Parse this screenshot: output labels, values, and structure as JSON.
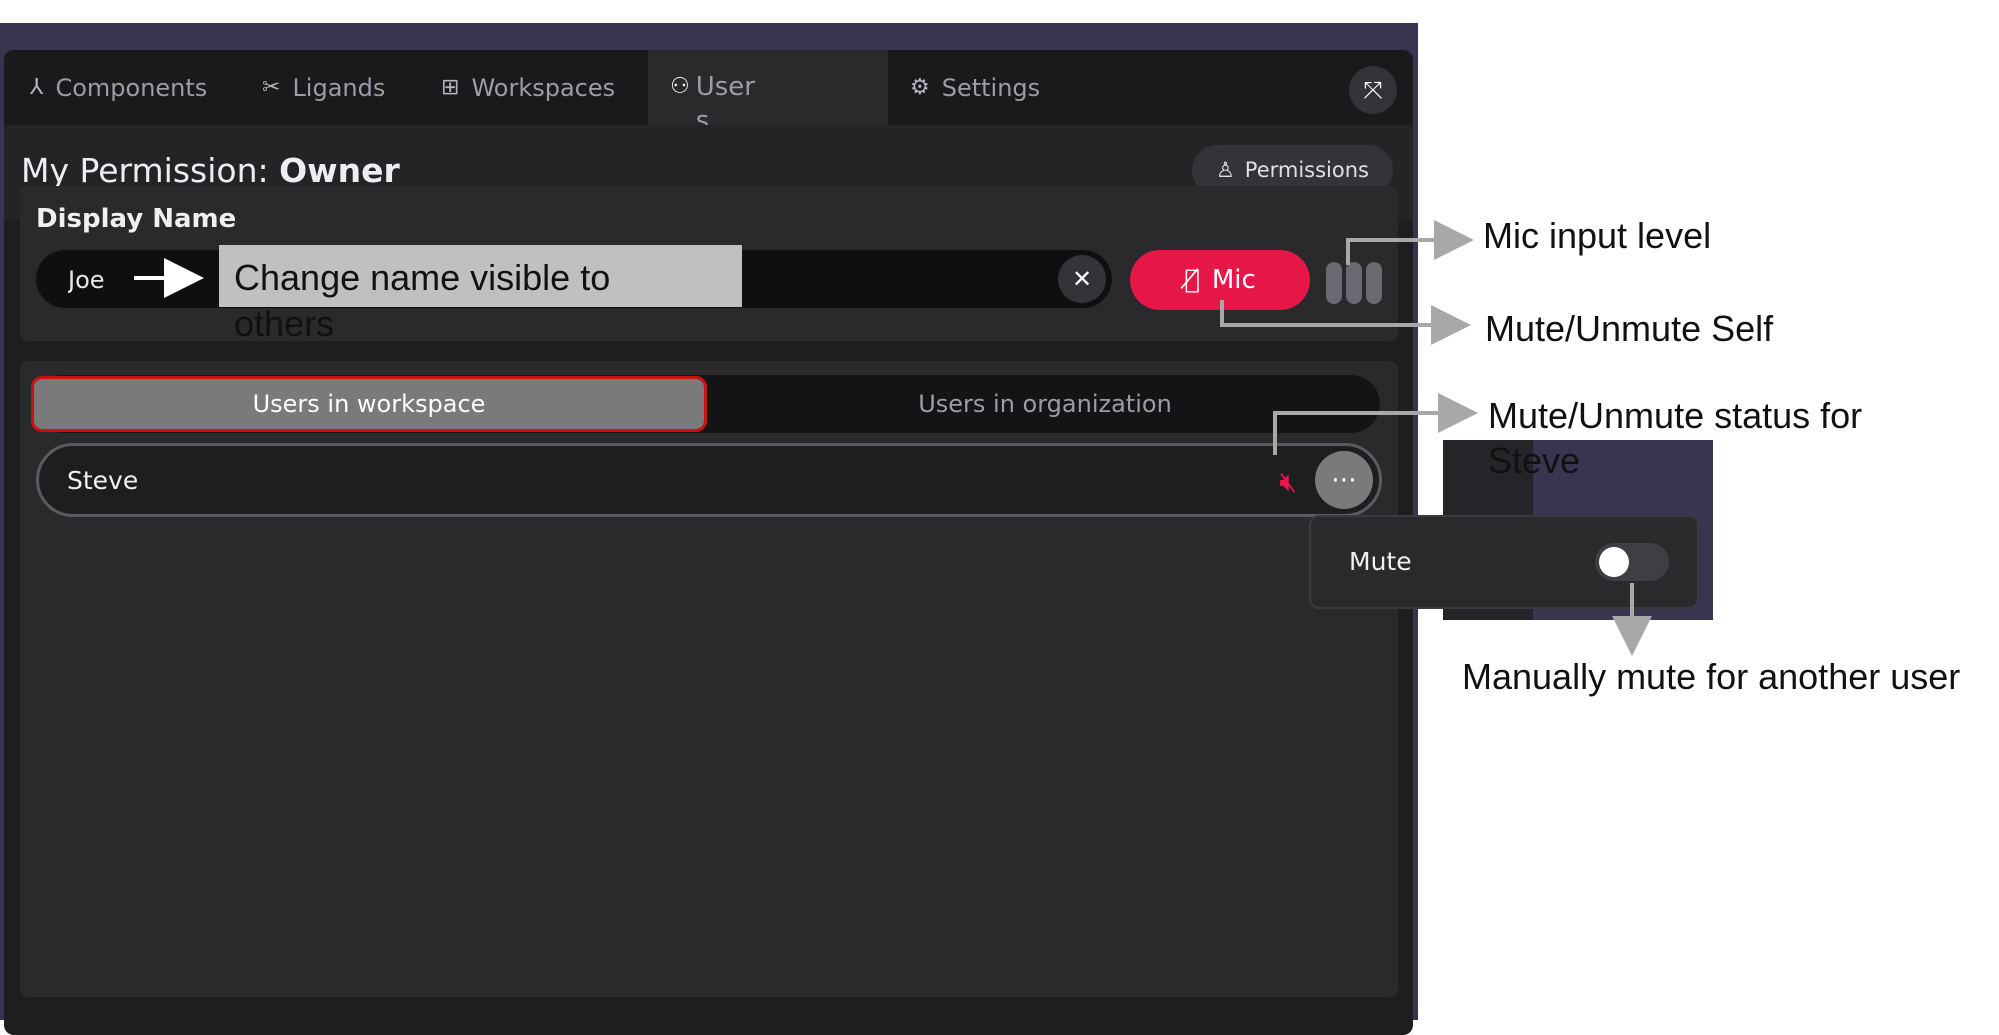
{
  "tabs": [
    {
      "label": "Components",
      "icon": "components-icon"
    },
    {
      "label": "Ligands",
      "icon": "ligands-icon"
    },
    {
      "label": "Workspaces",
      "icon": "workspaces-icon"
    },
    {
      "label": "Users",
      "icon": "users-icon",
      "active": true
    },
    {
      "label": "Settings",
      "icon": "gear-icon"
    }
  ],
  "permission": {
    "prefix": "My Permission:",
    "value": "Owner",
    "button_label": "Permissions"
  },
  "display_name": {
    "label": "Display Name",
    "value": "Joe"
  },
  "mic": {
    "label": "Mic",
    "state": "muted",
    "accent": "#e8174a"
  },
  "user_tabs": {
    "workspace": "Users in workspace",
    "organization": "Users in organization",
    "active": "workspace"
  },
  "users": [
    {
      "name": "Steve",
      "muted": true
    }
  ],
  "popover": {
    "label": "Mute",
    "toggle_on": false
  },
  "annotations": {
    "change_name": "Change name visible to others",
    "mic_level": "Mic input level",
    "mute_self": "Mute/Unmute Self",
    "mute_status": "Mute/Unmute status for Steve",
    "manual_mute": "Manually mute for another user"
  }
}
